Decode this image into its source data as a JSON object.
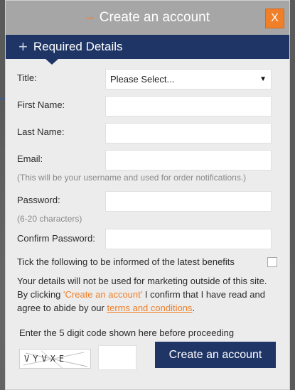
{
  "modal": {
    "title": "Create an account",
    "close_label": "X"
  },
  "section": {
    "title": "Required Details"
  },
  "fields": {
    "title_label": "Title:",
    "title_value": "Please Select...",
    "first_name_label": "First Name:",
    "last_name_label": "Last Name:",
    "email_label": "Email:",
    "email_hint": "(This will be your username and used for order notifications.)",
    "password_label": "Password:",
    "password_hint": "(6-20 characters)",
    "confirm_password_label": "Confirm Password:"
  },
  "consent": {
    "benefits_text": "Tick the following to be informed of the latest benefits",
    "marketing_text_1": "Your details will not be used for marketing outside of this site. By clicking ",
    "marketing_quote": "'Create an account'",
    "marketing_text_2": " I confirm that I have read and agree to abide by our ",
    "terms_link": "terms and conditions",
    "marketing_text_3": "."
  },
  "captcha": {
    "instruction": "Enter the 5 digit code shown here before proceeding",
    "code_image_text": "VYVXE"
  },
  "submit": {
    "label": "Create an account"
  },
  "colors": {
    "navy": "#1f3566",
    "orange": "#f07f2a",
    "header_gray": "#a6a6a6",
    "modal_bg": "#ececec"
  }
}
